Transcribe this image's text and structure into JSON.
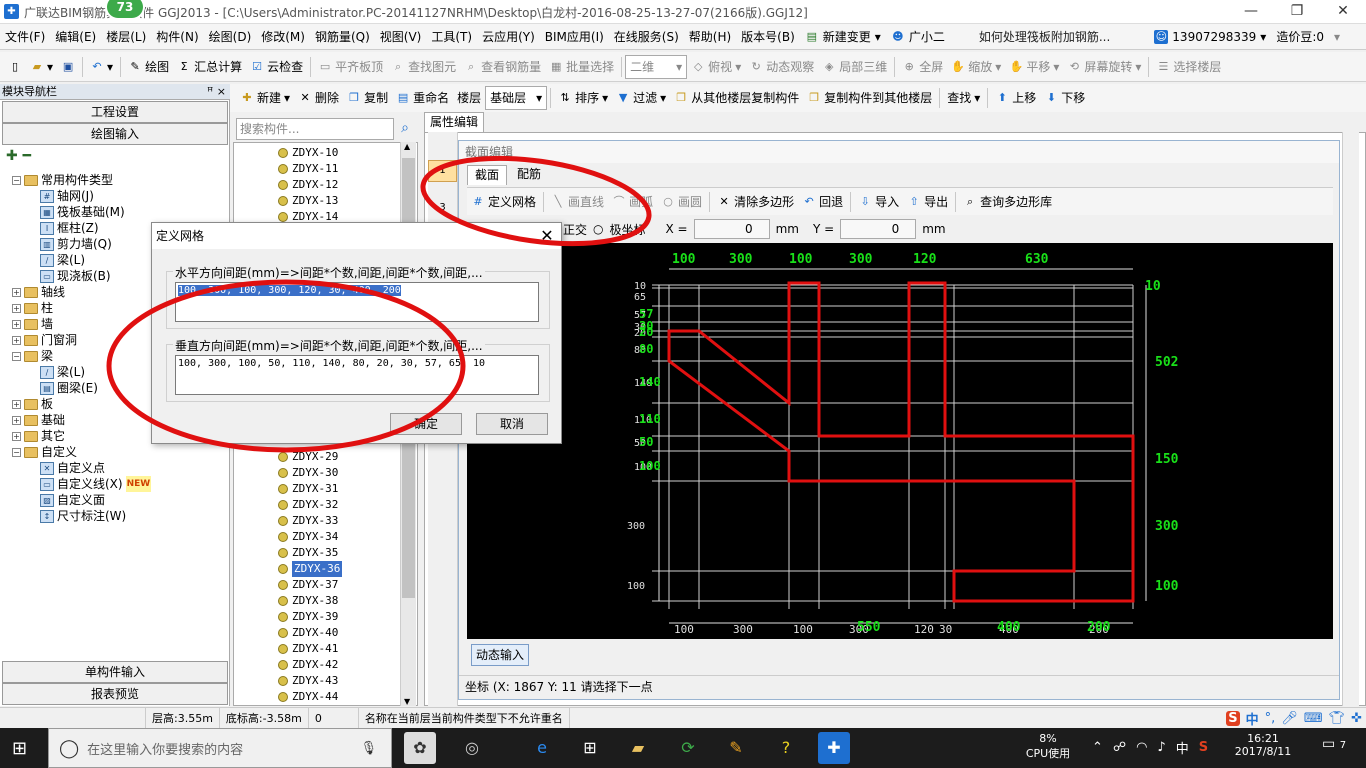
{
  "titlebar": {
    "title": "广联达BIM钢筋算量软件 GGJ2013 - [C:\\Users\\Administrator.PC-20141127NRHM\\Desktop\\白龙村-2016-08-25-13-27-07(2166版).GGJ12]",
    "badge": "73",
    "min": "—",
    "restore": "❐",
    "close": "✕"
  },
  "menu": [
    "文件(F)",
    "编辑(E)",
    "楼层(L)",
    "构件(N)",
    "绘图(D)",
    "修改(M)",
    "钢筋量(Q)",
    "视图(V)",
    "工具(T)",
    "云应用(Y)",
    "BIM应用(I)",
    "在线服务(S)",
    "帮助(H)",
    "版本号(B)"
  ],
  "menu_right": {
    "new_change": "新建变更",
    "guang": "广小二",
    "ad": "如何处理筏板附加钢筋...",
    "phone": "13907298339",
    "price": "造价豆:0"
  },
  "toolbar1": {
    "draw": "绘图",
    "sum": "汇总计算",
    "cloud": "云检查",
    "flat": "平齐板顶",
    "find": "查找图元",
    "view_rebar": "查看钢筋量",
    "batch": "批量选择",
    "mode": "二维",
    "top": "俯视",
    "dyn": "动态观察",
    "local3d": "局部三维",
    "full": "全屏",
    "zoom": "缩放",
    "pan": "平移",
    "rotate": "屏幕旋转",
    "sel_floor": "选择楼层"
  },
  "toolbar2": {
    "new": "新建",
    "del": "删除",
    "copy": "复制",
    "rename": "重命名",
    "floor": "楼层",
    "base": "基础层",
    "sort": "排序",
    "filter": "过滤",
    "copy_from": "从其他楼层复制构件",
    "copy_to": "复制构件到其他楼层",
    "find": "查找",
    "up": "上移",
    "down": "下移"
  },
  "leftpanel": {
    "header": "模块导航栏",
    "pin": "ꟸ ×",
    "eng": "工程设置",
    "draw_input": "绘图输入",
    "single": "单构件输入",
    "report": "报表预览",
    "tree": [
      {
        "t": "常用构件类型",
        "lvl": 0,
        "type": "folder",
        "open": true
      },
      {
        "t": "轴网(J)",
        "lvl": 1,
        "type": "comp",
        "ico": "#"
      },
      {
        "t": "筏板基础(M)",
        "lvl": 1,
        "type": "comp",
        "ico": "▦"
      },
      {
        "t": "框柱(Z)",
        "lvl": 1,
        "type": "comp",
        "ico": "I"
      },
      {
        "t": "剪力墙(Q)",
        "lvl": 1,
        "type": "comp",
        "ico": "▥"
      },
      {
        "t": "梁(L)",
        "lvl": 1,
        "type": "comp",
        "ico": "∕"
      },
      {
        "t": "现浇板(B)",
        "lvl": 1,
        "type": "comp",
        "ico": "▭"
      },
      {
        "t": "轴线",
        "lvl": 0,
        "type": "folder"
      },
      {
        "t": "柱",
        "lvl": 0,
        "type": "folder"
      },
      {
        "t": "墙",
        "lvl": 0,
        "type": "folder"
      },
      {
        "t": "门窗洞",
        "lvl": 0,
        "type": "folder"
      },
      {
        "t": "梁",
        "lvl": 0,
        "type": "folder",
        "open": true
      },
      {
        "t": "梁(L)",
        "lvl": 1,
        "type": "comp",
        "ico": "∕"
      },
      {
        "t": "圈梁(E)",
        "lvl": 1,
        "type": "comp",
        "ico": "▤"
      },
      {
        "t": "板",
        "lvl": 0,
        "type": "folder"
      },
      {
        "t": "基础",
        "lvl": 0,
        "type": "folder"
      },
      {
        "t": "其它",
        "lvl": 0,
        "type": "folder"
      },
      {
        "t": "自定义",
        "lvl": 0,
        "type": "folder",
        "open": true
      },
      {
        "t": "自定义点",
        "lvl": 1,
        "type": "comp",
        "ico": "✕"
      },
      {
        "t": "自定义线(X)",
        "lvl": 1,
        "type": "comp",
        "ico": "▭",
        "new": "NEW"
      },
      {
        "t": "自定义面",
        "lvl": 1,
        "type": "comp",
        "ico": "▨"
      },
      {
        "t": "尺寸标注(W)",
        "lvl": 1,
        "type": "comp",
        "ico": "↕"
      }
    ]
  },
  "midpanel": {
    "search_placeholder": "搜索构件...",
    "items": [
      "ZDYX-10",
      "ZDYX-11",
      "ZDYX-12",
      "ZDYX-13",
      "ZDYX-14",
      "ZDYX-29",
      "ZDYX-30",
      "ZDYX-31",
      "ZDYX-32",
      "ZDYX-33",
      "ZDYX-34",
      "ZDYX-35",
      "ZDYX-36",
      "ZDYX-37",
      "ZDYX-38",
      "ZDYX-39",
      "ZDYX-40",
      "ZDYX-41",
      "ZDYX-42",
      "ZDYX-43",
      "ZDYX-44"
    ],
    "selected": "ZDYX-36"
  },
  "prop": {
    "tab": "属性编辑",
    "rows": [
      "1",
      "3"
    ]
  },
  "section": {
    "title": "截面编辑",
    "tab1": "截面",
    "tab2": "配筋",
    "define_grid": "定义网格",
    "line": "画直线",
    "arc": "画弧",
    "circle": "画圆",
    "clear": "清除多边形",
    "undo": "回退",
    "import": "导入",
    "export": "导出",
    "query": "查询多边形库",
    "ortho": "正交",
    "polar": "极坐标",
    "x_label": "X =",
    "x_val": "0",
    "y_label": "Y =",
    "y_val": "0",
    "unit": "mm",
    "dyn_input": "动态输入",
    "coord": "坐标 (X: 1867 Y: 11",
    "prompt": "请选择下一点"
  },
  "dialog": {
    "title": "定义网格",
    "h_label": "水平方向间距(mm)=>间距*个数,间距,间距*个数,间距,...",
    "h_value": "100, 300, 100, 300, 120, 30, 400, 200",
    "v_label": "垂直方向间距(mm)=>间距*个数,间距,间距*个数,间距,...",
    "v_value": "100, 300, 100, 50, 110, 140, 80, 20, 30, 57, 65, 10",
    "ok": "确定",
    "cancel": "取消"
  },
  "canvas": {
    "top_dims": [
      "100",
      "300",
      "100",
      "300",
      "120",
      "630"
    ],
    "bottom_dims": [
      "100",
      "300",
      "100",
      "300",
      "120",
      "30",
      "400",
      "200"
    ],
    "bottom_green": [
      "550",
      "400",
      "200"
    ],
    "right_dims": [
      "10",
      "502",
      "150",
      "300",
      "100"
    ],
    "left_dims": [
      "10",
      "65",
      "57",
      "30",
      "20",
      "80",
      "140",
      "110",
      "50",
      "100",
      "300",
      "100"
    ],
    "left_green": [
      "57",
      "30",
      "20",
      "80",
      "140",
      "110",
      "50",
      "100"
    ]
  },
  "status": {
    "floor_h": "层高:3.55m",
    "floor_base": "底标高:-3.58m",
    "zero": "0",
    "msg": "名称在当前层当前构件类型下不允许重名"
  },
  "taskbar": {
    "search": "在这里输入你要搜索的内容",
    "cpu_pct": "8%",
    "cpu": "CPU使用",
    "ime": "中",
    "time": "16:21",
    "date": "2017/8/11",
    "notif": "7"
  },
  "colors": {
    "accent": "#3a6fc8",
    "red": "#e01010",
    "green": "#19e019"
  }
}
